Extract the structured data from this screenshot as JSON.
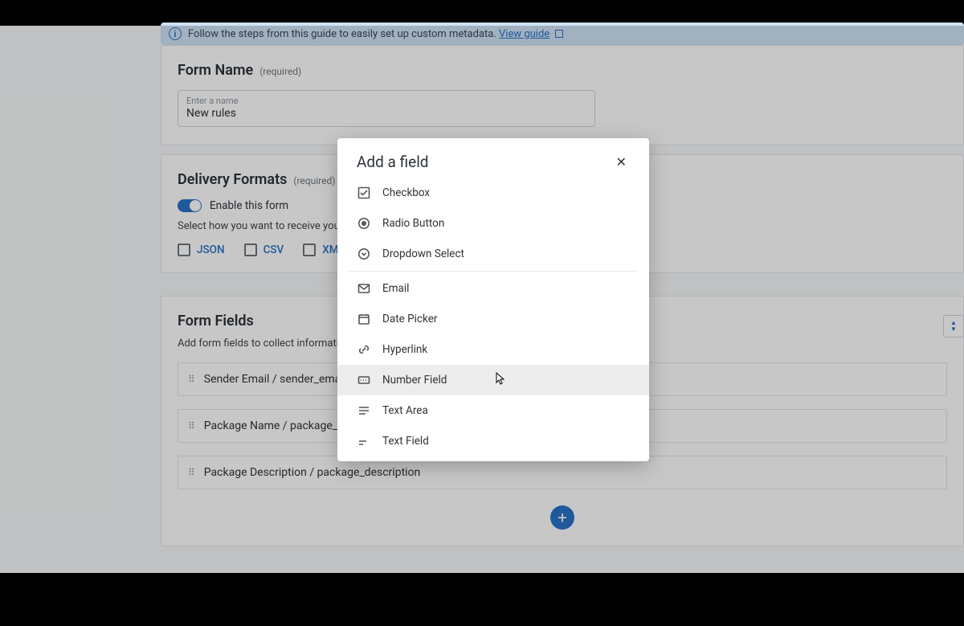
{
  "tip": {
    "prefix": "Follow the steps from this guide to easily set up custom metadata.",
    "link": "View guide"
  },
  "formName": {
    "title": "Form Name",
    "required": "(required)",
    "placeholder": "Enter a name",
    "value": "New rules"
  },
  "delivery": {
    "title": "Delivery Formats",
    "required": "(required)",
    "toggleLabel": "Enable this form",
    "help": "Select how you want to receive your metadata.",
    "formats": [
      "JSON",
      "CSV",
      "XML"
    ]
  },
  "formFields": {
    "title": "Form Fields",
    "desc": "Add form fields to collect information about your package",
    "rows": [
      "Sender Email / sender_email",
      "Package Name / package_name",
      "Package Description / package_description"
    ]
  },
  "modal": {
    "title": "Add a field",
    "options": [
      {
        "id": "checkbox",
        "label": "Checkbox"
      },
      {
        "id": "radio",
        "label": "Radio Button"
      },
      {
        "id": "dropdown",
        "label": "Dropdown Select"
      },
      {
        "id": "email",
        "label": "Email"
      },
      {
        "id": "date",
        "label": "Date Picker"
      },
      {
        "id": "hyperlink",
        "label": "Hyperlink"
      },
      {
        "id": "number",
        "label": "Number Field"
      },
      {
        "id": "textarea",
        "label": "Text Area"
      },
      {
        "id": "textfield",
        "label": "Text Field"
      }
    ],
    "hoverIndex": 6
  }
}
